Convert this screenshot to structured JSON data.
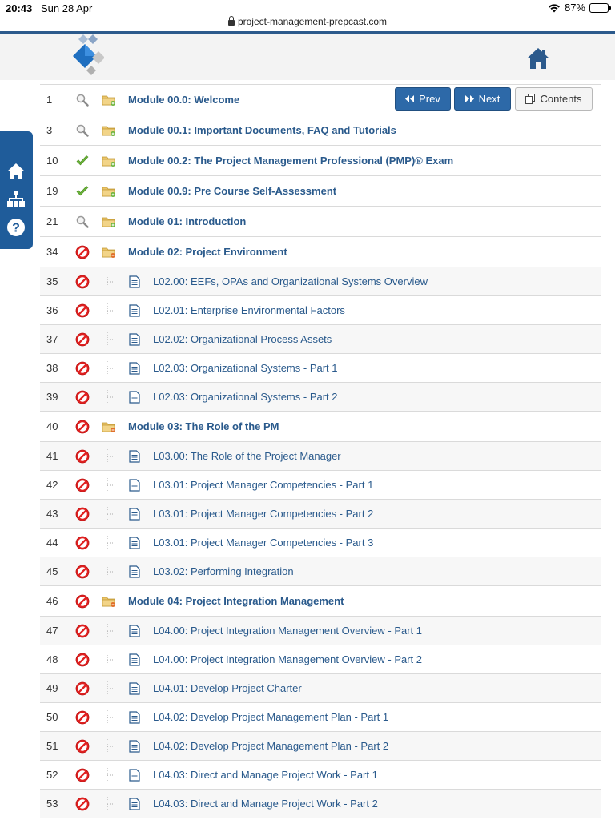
{
  "status_bar": {
    "time": "20:43",
    "date": "Sun 28 Apr",
    "battery": "87%",
    "battery_level": 0.87
  },
  "url": "project-management-prepcast.com",
  "nav": {
    "prev": "Prev",
    "next": "Next",
    "contents": "Contents"
  },
  "rows": [
    {
      "num": "1",
      "type": "module",
      "status": "viewed",
      "title": "Module 00.0: Welcome"
    },
    {
      "num": "3",
      "type": "module",
      "status": "viewed",
      "title": "Module 00.1: Important Documents, FAQ and Tutorials"
    },
    {
      "num": "10",
      "type": "module",
      "status": "completed",
      "title": "Module 00.2: The Project Management Professional (PMP)® Exam"
    },
    {
      "num": "19",
      "type": "module",
      "status": "completed",
      "title": "Module 00.9: Pre Course Self-Assessment"
    },
    {
      "num": "21",
      "type": "module",
      "status": "viewed",
      "title": "Module 01: Introduction"
    },
    {
      "num": "34",
      "type": "module",
      "status": "not-started",
      "title": "Module 02: Project Environment"
    },
    {
      "num": "35",
      "type": "lesson",
      "status": "not-started",
      "title": "L02.00: EEFs, OPAs and Organizational Systems Overview"
    },
    {
      "num": "36",
      "type": "lesson",
      "status": "not-started",
      "title": "L02.01: Enterprise Environmental Factors"
    },
    {
      "num": "37",
      "type": "lesson",
      "status": "not-started",
      "title": "L02.02: Organizational Process Assets"
    },
    {
      "num": "38",
      "type": "lesson",
      "status": "not-started",
      "title": "L02.03: Organizational Systems - Part 1"
    },
    {
      "num": "39",
      "type": "lesson",
      "status": "not-started",
      "title": "L02.03: Organizational Systems - Part 2"
    },
    {
      "num": "40",
      "type": "module",
      "status": "not-started",
      "title": "Module 03: The Role of the PM"
    },
    {
      "num": "41",
      "type": "lesson",
      "status": "not-started",
      "title": "L03.00: The Role of the Project Manager"
    },
    {
      "num": "42",
      "type": "lesson",
      "status": "not-started",
      "title": "L03.01: Project Manager Competencies - Part 1"
    },
    {
      "num": "43",
      "type": "lesson",
      "status": "not-started",
      "title": "L03.01: Project Manager Competencies - Part 2"
    },
    {
      "num": "44",
      "type": "lesson",
      "status": "not-started",
      "title": "L03.01: Project Manager Competencies - Part 3"
    },
    {
      "num": "45",
      "type": "lesson",
      "status": "not-started",
      "title": "L03.02: Performing Integration"
    },
    {
      "num": "46",
      "type": "module",
      "status": "not-started",
      "title": "Module 04: Project Integration Management"
    },
    {
      "num": "47",
      "type": "lesson",
      "status": "not-started",
      "title": "L04.00: Project Integration Management Overview - Part 1"
    },
    {
      "num": "48",
      "type": "lesson",
      "status": "not-started",
      "title": "L04.00: Project Integration Management Overview - Part 2"
    },
    {
      "num": "49",
      "type": "lesson",
      "status": "not-started",
      "title": "L04.01: Develop Project Charter"
    },
    {
      "num": "50",
      "type": "lesson",
      "status": "not-started",
      "title": "L04.02: Develop Project Management Plan - Part 1"
    },
    {
      "num": "51",
      "type": "lesson",
      "status": "not-started",
      "title": "L04.02: Develop Project Management Plan - Part 2"
    },
    {
      "num": "52",
      "type": "lesson",
      "status": "not-started",
      "title": "L04.03: Direct and Manage Project Work - Part 1"
    },
    {
      "num": "53",
      "type": "lesson",
      "status": "not-started",
      "title": "L04.03: Direct and Manage Project Work - Part 2"
    }
  ],
  "colors": {
    "accent": "#2c5a8c",
    "link": "#2a5a8c",
    "button": "#2d69a8",
    "ok": "#6bb33a",
    "no": "#e02020"
  },
  "icons": {
    "viewed": "magnifier-icon",
    "completed": "checkmark-icon",
    "not-started": "not-allowed-icon",
    "module": "folder-icon",
    "lesson": "document-icon"
  }
}
